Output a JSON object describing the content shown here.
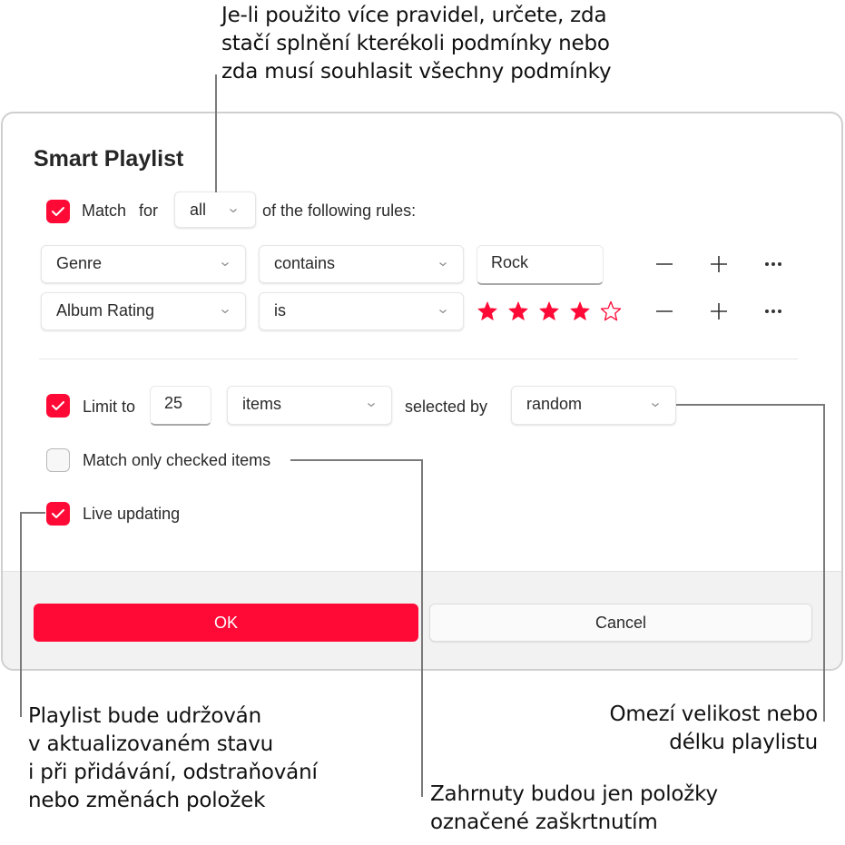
{
  "callouts": {
    "top": [
      "Je-li použito více pravidel, určete, zda",
      "stačí splnění kterékoli podmínky nebo",
      "zda musí souhlasit všechny podmínky"
    ],
    "bottom_left": [
      "Playlist bude udržován",
      "v aktualizovaném stavu",
      "i při přidávání, odstraňování",
      "nebo změnách položek"
    ],
    "bottom_middle": [
      "Zahrnuty budou jen položky",
      "označené zaškrtnutím"
    ],
    "bottom_right": [
      "Omezí velikost nebo",
      "délku playlistu"
    ]
  },
  "dialog": {
    "title": "Smart Playlist",
    "match": {
      "checked": true,
      "label_match": "Match",
      "label_for": "for",
      "selector": "all",
      "suffix": "of the following rules:"
    },
    "rules": [
      {
        "field": "Genre",
        "operator": "contains",
        "value": "Rock"
      },
      {
        "field": "Album Rating",
        "operator": "is",
        "rating": 4,
        "rating_max": 5
      }
    ],
    "rule_actions": {
      "remove": "−",
      "add": "+",
      "more": "···"
    },
    "limit": {
      "checked": true,
      "label": "Limit to",
      "value": "25",
      "unit": "items",
      "selected_by_label": "selected by",
      "selected_by": "random"
    },
    "match_only_checked": {
      "checked": false,
      "label": "Match only checked items"
    },
    "live_updating": {
      "checked": true,
      "label": "Live updating"
    },
    "buttons": {
      "ok": "OK",
      "cancel": "Cancel"
    }
  },
  "colors": {
    "accent": "#ff0a36",
    "footer_bg": "#f2f2f2",
    "border": "#cfcfcf",
    "callout_line": "#7a7a7a"
  }
}
